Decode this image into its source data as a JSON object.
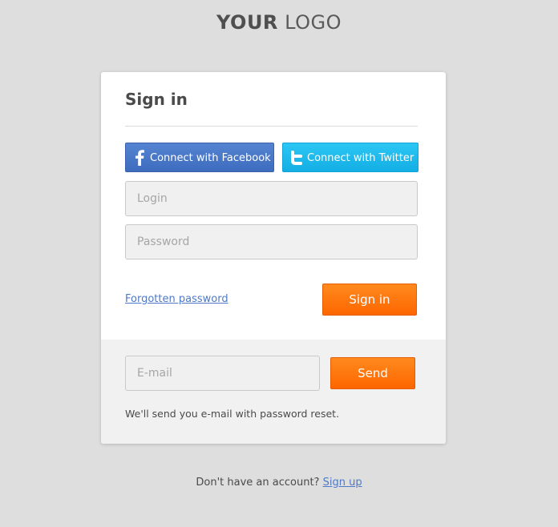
{
  "logo": {
    "bold": "YOUR",
    "light": "LOGO"
  },
  "signin": {
    "title": "Sign in",
    "facebook_label": "Connect with Facebook",
    "twitter_label": "Connect with Twitter",
    "login_placeholder": "Login",
    "password_placeholder": "Password",
    "forgot_label": "Forgotten password",
    "submit_label": "Sign in"
  },
  "reset": {
    "email_placeholder": "E-mail",
    "send_label": "Send",
    "note": "We'll send you e-mail with password reset."
  },
  "footer": {
    "prompt": "Don't have an account?",
    "signup_label": "Sign up"
  },
  "colors": {
    "background": "#dedede",
    "facebook": "#4a78c8",
    "twitter": "#1fb8ec",
    "accent_orange": "#fd7308",
    "link": "#4e79c6"
  },
  "icons": {
    "facebook": "facebook-icon",
    "twitter": "twitter-icon"
  }
}
